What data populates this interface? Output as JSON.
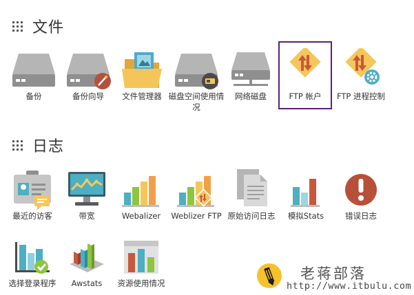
{
  "sections": {
    "files": {
      "title": "文件"
    },
    "logs": {
      "title": "日志"
    }
  },
  "files_items": [
    {
      "label": "备份",
      "icon": "hard-drive-icon"
    },
    {
      "label": "备份向导",
      "icon": "backup-wizard-icon"
    },
    {
      "label": "文件管理器",
      "icon": "folder-icon"
    },
    {
      "label": "磁盘空间使用情况",
      "icon": "disk-usage-icon"
    },
    {
      "label": "网络磁盘",
      "icon": "network-drive-icon"
    },
    {
      "label": "FTP 帐户",
      "icon": "ftp-accounts-icon"
    },
    {
      "label": "FTP 进程控制",
      "icon": "ftp-session-control-icon"
    }
  ],
  "logs_items": [
    {
      "label": "最近的访客",
      "icon": "visitors-icon"
    },
    {
      "label": "带宽",
      "icon": "bandwidth-monitor-icon"
    },
    {
      "label": "Webalizer",
      "icon": "bar-chart-icon"
    },
    {
      "label": "Weblizer FTP",
      "icon": "bar-chart-ftp-icon"
    },
    {
      "label": "原始访问日志",
      "icon": "raw-log-document-icon"
    },
    {
      "label": "模拟Stats",
      "icon": "analog-stats-icon"
    },
    {
      "label": "错误日志",
      "icon": "error-icon"
    },
    {
      "label": "选择登录程序",
      "icon": "choose-log-program-icon"
    },
    {
      "label": "Awstats",
      "icon": "awstats-icon"
    },
    {
      "label": "资源使用情况",
      "icon": "resource-usage-icon"
    }
  ],
  "watermark": {
    "title": "老蒋部落",
    "url": "http://www.itbulu.com",
    "icon": "pencil-logo-icon"
  },
  "colors": {
    "highlight_border": "#5a1f78",
    "drive_gray": "#b0b0b0",
    "accent_yellow": "#f6c65b",
    "accent_red": "#c9573c",
    "accent_teal": "#4cafc2"
  }
}
